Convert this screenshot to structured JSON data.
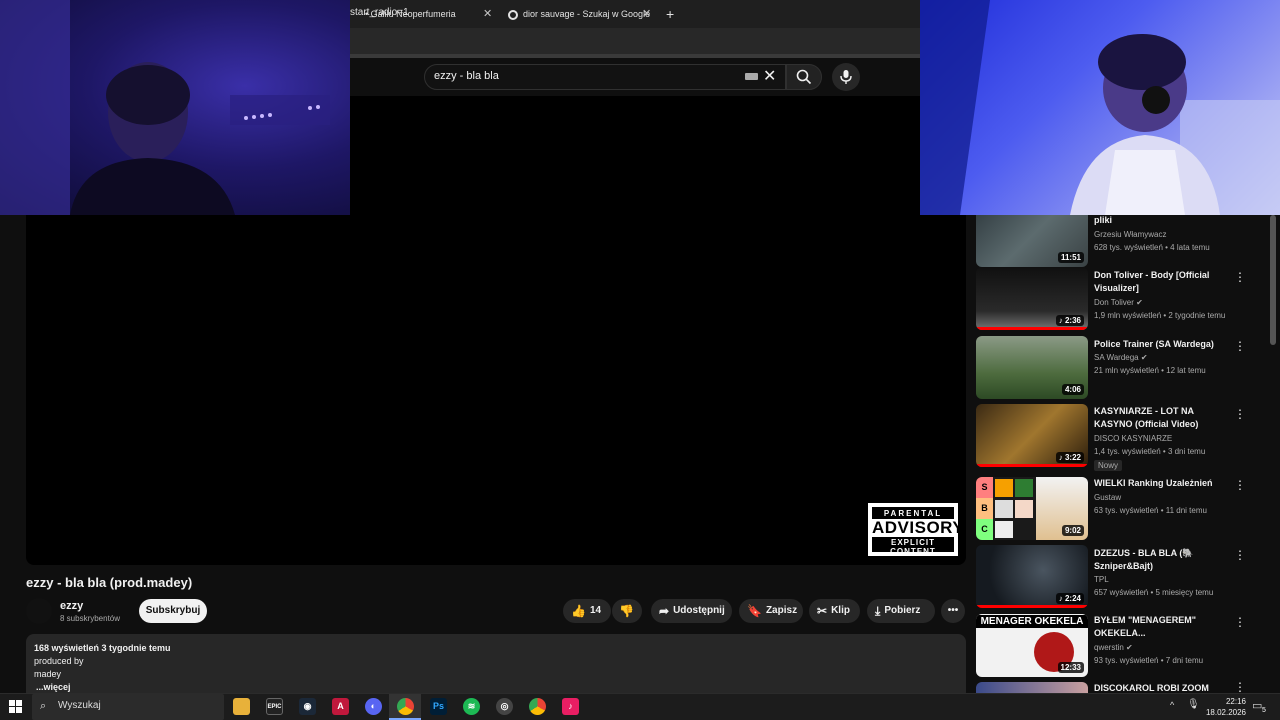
{
  "browser": {
    "tabs": [
      {
        "label": "• Galilu Neoperfumeria"
      },
      {
        "label": "dior sauvage - Szukaj w Google"
      }
    ],
    "url_fragment": "start_radio=1"
  },
  "youtube": {
    "search_query": "ezzy - bla bla",
    "video": {
      "title": "ezzy - bla bla (prod.madey)",
      "channel": "ezzy",
      "subscribers": "8 subskrybentów",
      "subscribe_label": "Subskrybuj",
      "likes": "14",
      "share_label": "Udostępnij",
      "save_label": "Zapisz",
      "clip_label": "Klip",
      "download_label": "Pobierz",
      "advisory": {
        "line1": "PARENTAL",
        "line2": "ADVISORY",
        "line3": "EXPLICIT CONTENT"
      },
      "description": {
        "stats": "168 wyświetleń  3 tygodnie temu",
        "line1": "produced by",
        "line2": "madey",
        "more": "...więcej"
      }
    },
    "recommendations": [
      {
        "title": "pliki",
        "channel": "Grzesiu Włamywacz",
        "meta": "628 tys. wyświetleń • 4 lata temu",
        "duration": "11:51"
      },
      {
        "title": "Don Toliver - Body [Official Visualizer]",
        "channel": "Don Toliver",
        "meta": "1,9 mln wyświetleń • 2 tygodnie temu",
        "duration": "2:36"
      },
      {
        "title": "Police Trainer (SA Wardega)",
        "channel": "SA Wardega",
        "meta": "21 mln wyświetleń • 12 lat temu",
        "duration": "4:06"
      },
      {
        "title": "KASYNIARZE - LOT NA KASYNO (Official Video)",
        "channel": "DISCO KASYNIARZE",
        "meta": "1,4 tys. wyświetleń • 3 dni temu",
        "duration": "3:22",
        "badge": "Nowy"
      },
      {
        "title": "WIELKI Ranking Uzależnień",
        "channel": "Gustaw",
        "meta": "63 tys. wyświetleń • 11 dni temu",
        "duration": "9:02"
      },
      {
        "title": "DZEZUS - BLA BLA (🐘 Szniper&Bajt)",
        "channel": "TPL",
        "meta": "657 wyświetleń • 5 miesięcy temu",
        "duration": "2:24"
      },
      {
        "title": "BYŁEM \"MENAGEREM\" OKEKELA...",
        "channel": "qwerstin",
        "meta": "93 tys. wyświetleń • 7 dni temu",
        "duration": "12:33",
        "thumb_text": "MENAGER OKEKELA"
      },
      {
        "title": "DISCOKAROL ROBI ZOOM",
        "channel": "",
        "meta": "",
        "duration": ""
      }
    ],
    "tier_letters": [
      "S",
      "B",
      "C"
    ]
  },
  "taskbar": {
    "search_placeholder": "Wyszukaj",
    "time": "22:16",
    "date": "18.02.2026",
    "notifications": "5"
  }
}
